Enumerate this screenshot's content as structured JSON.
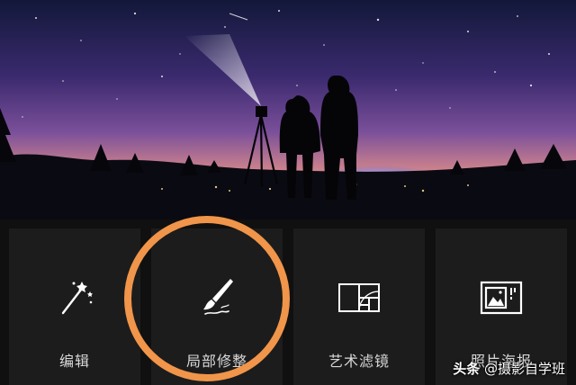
{
  "toolbar": {
    "items": [
      {
        "label": "编辑",
        "icon": "magic-wand-icon"
      },
      {
        "label": "局部修整",
        "icon": "brush-icon"
      },
      {
        "label": "艺术滤镜",
        "icon": "golden-ratio-icon"
      },
      {
        "label": "照片海报",
        "icon": "photo-poster-icon"
      }
    ]
  },
  "watermark": {
    "brand": "头条",
    "handle": "@摄影自学班"
  },
  "colors": {
    "highlight_ring": "#f0954a",
    "tile_bg": "#1c1c1c"
  }
}
